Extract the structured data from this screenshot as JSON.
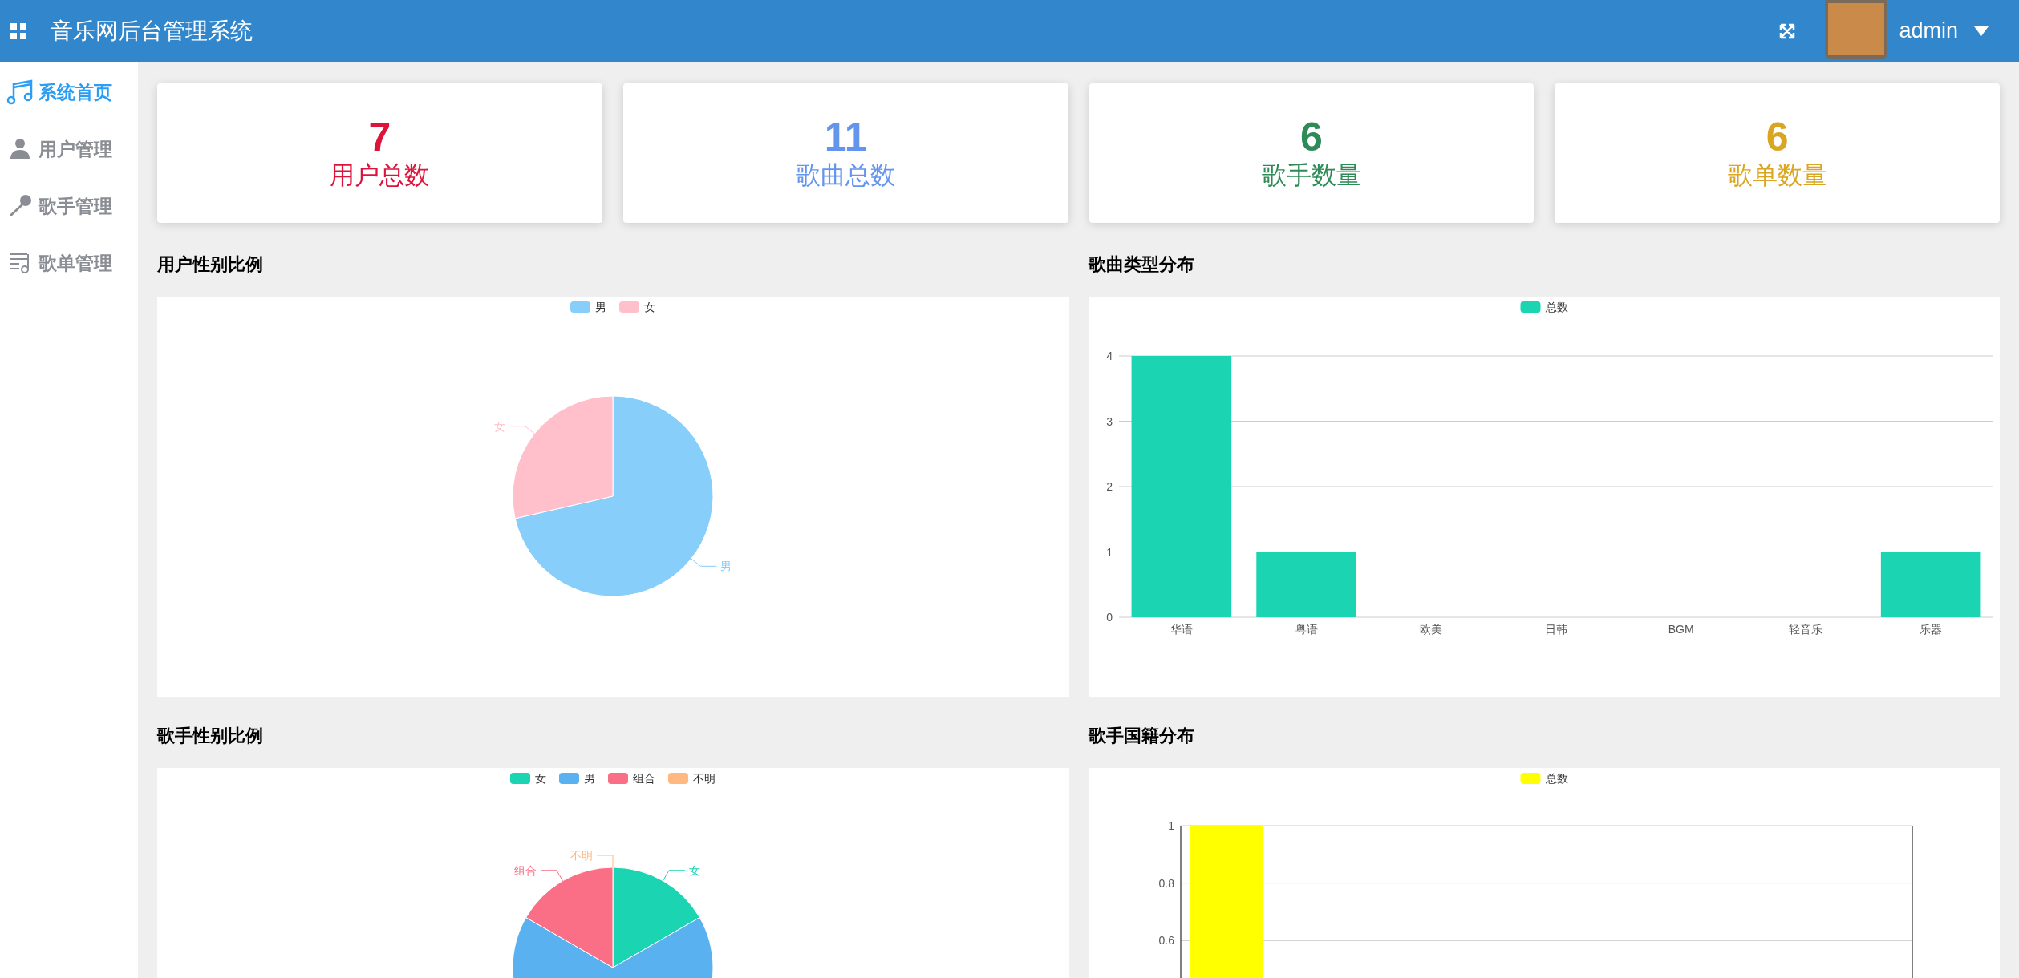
{
  "header": {
    "title": "音乐网后台管理系统",
    "user": "admin"
  },
  "sidebar": {
    "items": [
      {
        "label": "系统首页",
        "kind": "note",
        "selected": true
      },
      {
        "label": "用户管理",
        "kind": "person",
        "selected": false
      },
      {
        "label": "歌手管理",
        "kind": "mic",
        "selected": false
      },
      {
        "label": "歌单管理",
        "kind": "list",
        "selected": false
      }
    ]
  },
  "stats": [
    {
      "value": "7",
      "label": "用户总数",
      "color": "#dc143c"
    },
    {
      "value": "11",
      "label": "歌曲总数",
      "color": "#6495ed"
    },
    {
      "value": "6",
      "label": "歌手数量",
      "color": "#2e8b57"
    },
    {
      "value": "6",
      "label": "歌单数量",
      "color": "#daa520"
    }
  ],
  "charts": [
    {
      "title": "用户性别比例",
      "chart_data": {
        "type": "pie",
        "categories": [
          "男",
          "女"
        ],
        "series": [
          {
            "colors": [
              "#87cefa",
              "#ffc0cb"
            ],
            "values": [
              71.43,
              28.57
            ]
          }
        ],
        "legend": "top"
      }
    },
    {
      "title": "歌曲类型分布",
      "chart_data": {
        "type": "bar",
        "categories": [
          "华语",
          "粤语",
          "欧美",
          "日韩",
          "BGM",
          "轻音乐",
          "乐器"
        ],
        "series": [
          {
            "name": "总数",
            "color": "#1bd4b2",
            "values": [
              4,
              1,
              0,
              0,
              0,
              0,
              1
            ]
          }
        ],
        "ylim": [
          0,
          4
        ],
        "yticks": [
          0,
          1,
          2,
          3,
          4
        ],
        "legend": "top",
        "grid": true
      }
    },
    {
      "title": "歌手性别比例",
      "chart_data": {
        "type": "pie",
        "categories": [
          "女",
          "男",
          "组合",
          "不明"
        ],
        "series": [
          {
            "colors": [
              "#1bd4b2",
              "#5ab1ef",
              "#fa6e86",
              "#ffb980"
            ],
            "values": [
              16.67,
              66.66,
              16.67,
              0
            ]
          }
        ],
        "legend": "top"
      }
    },
    {
      "title": "歌手国籍分布",
      "chart_data": {
        "type": "bar",
        "series": [
          {
            "name": "总数",
            "color": "#ffff00",
            "values": [
              1
            ]
          }
        ],
        "ylim": [
          0.4,
          1
        ],
        "legend": "top",
        "grid": true,
        "yticks": [
          {
            "value": 0.6,
            "label": "0.6"
          },
          {
            "value": 0.8,
            "label": "0.8"
          },
          {
            "value": 1,
            "label": "1"
          }
        ]
      }
    }
  ]
}
